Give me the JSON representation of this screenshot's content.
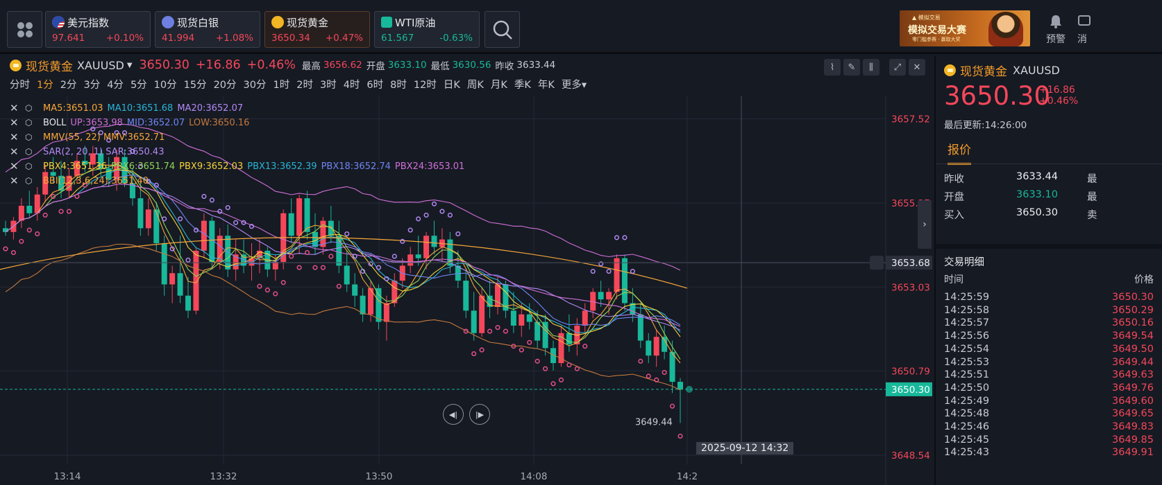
{
  "topbar": {
    "tickers": [
      {
        "name": "美元指数",
        "price": "97.641",
        "change": "+0.10%",
        "icon": "us-flag-icon",
        "dir": "up"
      },
      {
        "name": "现货白银",
        "price": "41.994",
        "change": "+1.08%",
        "icon": "silver-icon",
        "dir": "up"
      },
      {
        "name": "现货黄金",
        "price": "3650.34",
        "change": "+0.47%",
        "icon": "gold-icon",
        "dir": "up"
      },
      {
        "name": "WTI原油",
        "price": "61.567",
        "change": "-0.63%",
        "icon": "oil-icon",
        "dir": "down"
      }
    ],
    "banner": {
      "line1": "▲ 模拟交易",
      "line2": "模拟交易大赛",
      "line3": "零门槛参赛 · 赢取大奖"
    },
    "alert_label": "预警",
    "msg_label": "消"
  },
  "chart_header": {
    "symbol_name": "现货黄金",
    "symbol_code": "XAUUSD",
    "price": "3650.30",
    "change": "+16.86",
    "change_pct": "+0.46%",
    "high_label": "最高",
    "high": "3656.62",
    "open_label": "开盘",
    "open": "3633.10",
    "low_label": "最低",
    "low": "3630.56",
    "prev_label": "昨收",
    "prev": "3633.44"
  },
  "periods": [
    "分时",
    "1分",
    "2分",
    "3分",
    "4分",
    "5分",
    "10分",
    "15分",
    "20分",
    "30分",
    "1时",
    "2时",
    "3时",
    "4时",
    "6时",
    "8时",
    "12时",
    "日K",
    "周K",
    "月K",
    "季K",
    "年K",
    "更多"
  ],
  "active_period": "1分",
  "indicators": [
    {
      "items": [
        {
          "t": "MA5:3651.03",
          "c": "#f7a73a"
        },
        {
          "t": "MA10:3651.68",
          "c": "#28b5d6"
        },
        {
          "t": "MA20:3652.07",
          "c": "#b38af5"
        }
      ]
    },
    {
      "items": [
        {
          "t": "BOLL",
          "c": "#e6e7ea"
        },
        {
          "t": "UP:3653.98",
          "c": "#d070d8"
        },
        {
          "t": "MID:3652.07",
          "c": "#6f86f2"
        },
        {
          "t": "LOW:3650.16",
          "c": "#c57a3d"
        }
      ]
    },
    {
      "items": [
        {
          "t": "MMV(55, 22) MMV:3652.71",
          "c": "#f7a73a"
        }
      ]
    },
    {
      "items": [
        {
          "t": "SAR(2, 20, 1) SAR:3650.43",
          "c": "#b38af5"
        }
      ]
    },
    {
      "items": [
        {
          "t": "PBX4:3651.36",
          "c": "#f3d23a"
        },
        {
          "t": "PBX6:3651.74",
          "c": "#8fd45a"
        },
        {
          "t": "PBX9:3652.03",
          "c": "#f3d23a"
        },
        {
          "t": "PBX13:3652.39",
          "c": "#28b5d6"
        },
        {
          "t": "PBX18:3652.74",
          "c": "#6f86f2"
        },
        {
          "t": "PBX24:3653.01",
          "c": "#d070d8"
        }
      ]
    },
    {
      "items": [
        {
          "t": "BBI(12,3,6,24):3651.40",
          "c": "#f7a73a"
        }
      ]
    }
  ],
  "chart_data": {
    "type": "candlestick",
    "y_axis_labels": [
      "3657.52",
      "3655.27",
      "3653.03",
      "3650.79",
      "3648.54"
    ],
    "x_axis_labels": [
      "13:14",
      "13:32",
      "13:50",
      "14:08",
      "14:2"
    ],
    "ylim": [
      3648.3,
      3657.9
    ],
    "crosshair_value": "3653.68",
    "last_price_tag": "3650.30",
    "low_marker": "3649.44",
    "crosshair_date": "2025-09-12 14:32",
    "candles": [
      [
        3654.6,
        3654.8,
        3654.4,
        3654.5
      ],
      [
        3654.5,
        3654.9,
        3654.3,
        3654.8
      ],
      [
        3654.8,
        3655.4,
        3654.6,
        3655.2
      ],
      [
        3655.2,
        3655.6,
        3654.9,
        3655.0
      ],
      [
        3655.0,
        3655.7,
        3654.8,
        3655.5
      ],
      [
        3655.5,
        3656.3,
        3655.3,
        3656.1
      ],
      [
        3656.1,
        3656.5,
        3655.8,
        3656.0
      ],
      [
        3656.0,
        3656.4,
        3655.4,
        3655.6
      ],
      [
        3655.6,
        3656.2,
        3655.4,
        3656.0
      ],
      [
        3656.0,
        3656.6,
        3655.8,
        3656.4
      ],
      [
        3656.4,
        3656.8,
        3656.1,
        3656.3
      ],
      [
        3656.3,
        3656.8,
        3656.0,
        3656.6
      ],
      [
        3656.6,
        3656.7,
        3656.0,
        3656.2
      ],
      [
        3656.2,
        3656.5,
        3655.7,
        3655.9
      ],
      [
        3655.9,
        3656.7,
        3655.6,
        3656.5
      ],
      [
        3656.5,
        3656.7,
        3655.7,
        3655.8
      ],
      [
        3655.8,
        3656.2,
        3655.2,
        3655.4
      ],
      [
        3655.4,
        3655.8,
        3654.4,
        3654.6
      ],
      [
        3654.6,
        3655.4,
        3654.4,
        3655.1
      ],
      [
        3655.1,
        3655.3,
        3654.0,
        3654.2
      ],
      [
        3654.2,
        3654.4,
        3652.8,
        3653.1
      ],
      [
        3653.1,
        3653.6,
        3652.6,
        3653.4
      ],
      [
        3653.4,
        3654.4,
        3652.6,
        3652.8
      ],
      [
        3652.8,
        3653.3,
        3652.2,
        3652.4
      ],
      [
        3652.4,
        3654.1,
        3652.3,
        3654.0
      ],
      [
        3654.0,
        3655.0,
        3653.8,
        3654.8
      ],
      [
        3654.8,
        3654.9,
        3653.5,
        3653.7
      ],
      [
        3653.7,
        3654.6,
        3653.5,
        3654.4
      ],
      [
        3654.4,
        3654.7,
        3653.3,
        3653.5
      ],
      [
        3653.5,
        3654.3,
        3653.2,
        3653.9
      ],
      [
        3653.9,
        3654.3,
        3653.4,
        3653.6
      ],
      [
        3653.6,
        3654.2,
        3653.2,
        3653.8
      ],
      [
        3653.8,
        3654.3,
        3653.4,
        3654.0
      ],
      [
        3654.0,
        3654.1,
        3653.3,
        3653.5
      ],
      [
        3653.5,
        3653.9,
        3653.2,
        3653.7
      ],
      [
        3653.7,
        3655.1,
        3653.5,
        3655.0
      ],
      [
        3655.0,
        3655.4,
        3654.2,
        3654.4
      ],
      [
        3654.4,
        3655.5,
        3653.9,
        3655.4
      ],
      [
        3655.4,
        3655.6,
        3654.3,
        3654.5
      ],
      [
        3654.5,
        3655.0,
        3653.9,
        3654.1
      ],
      [
        3654.1,
        3654.9,
        3653.9,
        3654.8
      ],
      [
        3654.8,
        3655.2,
        3654.2,
        3654.4
      ],
      [
        3654.4,
        3654.8,
        3653.4,
        3653.6
      ],
      [
        3653.6,
        3654.0,
        3652.9,
        3653.1
      ],
      [
        3653.1,
        3653.4,
        3652.5,
        3652.8
      ],
      [
        3652.8,
        3653.0,
        3652.1,
        3652.3
      ],
      [
        3652.3,
        3653.2,
        3652.1,
        3653.0
      ],
      [
        3653.0,
        3653.1,
        3651.9,
        3652.1
      ],
      [
        3652.1,
        3652.8,
        3651.6,
        3652.6
      ],
      [
        3652.6,
        3653.4,
        3652.5,
        3653.2
      ],
      [
        3653.2,
        3653.8,
        3653.0,
        3653.6
      ],
      [
        3653.6,
        3654.1,
        3653.4,
        3653.9
      ],
      [
        3653.9,
        3654.4,
        3653.6,
        3653.8
      ],
      [
        3653.8,
        3654.5,
        3653.5,
        3654.4
      ],
      [
        3654.4,
        3654.8,
        3653.9,
        3654.1
      ],
      [
        3654.1,
        3654.6,
        3653.7,
        3654.3
      ],
      [
        3654.3,
        3654.5,
        3653.4,
        3653.6
      ],
      [
        3653.6,
        3654.0,
        3653.0,
        3653.2
      ],
      [
        3653.2,
        3653.5,
        3652.2,
        3652.4
      ],
      [
        3652.4,
        3652.9,
        3651.6,
        3651.8
      ],
      [
        3651.8,
        3653.0,
        3651.7,
        3652.8
      ],
      [
        3652.8,
        3653.2,
        3652.2,
        3652.5
      ],
      [
        3652.5,
        3653.3,
        3652.3,
        3653.1
      ],
      [
        3653.1,
        3653.2,
        3652.2,
        3652.4
      ],
      [
        3652.4,
        3652.9,
        3651.8,
        3652.0
      ],
      [
        3652.0,
        3652.6,
        3651.7,
        3652.3
      ],
      [
        3652.3,
        3652.6,
        3651.9,
        3652.1
      ],
      [
        3652.1,
        3652.4,
        3651.4,
        3651.6
      ],
      [
        3652.1,
        3652.3,
        3651.2,
        3651.4
      ],
      [
        3651.4,
        3651.6,
        3650.8,
        3651.0
      ],
      [
        3651.0,
        3652.0,
        3650.9,
        3651.8
      ],
      [
        3651.8,
        3652.3,
        3651.3,
        3651.5
      ],
      [
        3651.5,
        3652.2,
        3651.2,
        3652.0
      ],
      [
        3652.0,
        3652.6,
        3651.8,
        3652.4
      ],
      [
        3652.4,
        3653.0,
        3652.2,
        3652.9
      ],
      [
        3652.9,
        3653.2,
        3652.5,
        3652.7
      ],
      [
        3652.7,
        3653.0,
        3652.3,
        3652.9
      ],
      [
        3652.9,
        3653.9,
        3652.7,
        3653.8
      ],
      [
        3653.8,
        3653.9,
        3652.4,
        3652.6
      ],
      [
        3652.6,
        3653.0,
        3652.1,
        3652.3
      ],
      [
        3652.3,
        3652.6,
        3651.4,
        3651.6
      ],
      [
        3651.6,
        3651.8,
        3651.0,
        3651.2
      ],
      [
        3651.2,
        3651.9,
        3650.9,
        3651.7
      ],
      [
        3651.7,
        3652.0,
        3651.1,
        3651.3
      ],
      [
        3651.3,
        3651.6,
        3650.2,
        3650.5
      ],
      [
        3650.5,
        3650.6,
        3649.4,
        3650.3
      ]
    ]
  },
  "right_panel": {
    "symbol_name": "现货黄金",
    "symbol_code": "XAUUSD",
    "price": "3650.30",
    "change": "+16.86",
    "change_pct": "+0.46%",
    "updated": "最后更新:14:26:00",
    "tab": "报价",
    "quotes": [
      {
        "label": "昨收",
        "value": "3633.44",
        "label2": "最",
        "cls": ""
      },
      {
        "label": "开盘",
        "value": "3633.10",
        "label2": "最",
        "cls": "down"
      },
      {
        "label": "买入",
        "value": "3650.30",
        "label2": "卖",
        "cls": ""
      }
    ],
    "trades_title": "交易明细",
    "trades_head": {
      "time": "时间",
      "price": "价格"
    },
    "trades": [
      [
        "14:25:59",
        "3650.30"
      ],
      [
        "14:25:58",
        "3650.29"
      ],
      [
        "14:25:57",
        "3650.16"
      ],
      [
        "14:25:56",
        "3649.54"
      ],
      [
        "14:25:54",
        "3649.50"
      ],
      [
        "14:25:53",
        "3649.44"
      ],
      [
        "14:25:51",
        "3649.63"
      ],
      [
        "14:25:50",
        "3649.76"
      ],
      [
        "14:25:49",
        "3649.60"
      ],
      [
        "14:25:48",
        "3649.65"
      ],
      [
        "14:25:46",
        "3649.83"
      ],
      [
        "14:25:45",
        "3649.85"
      ],
      [
        "14:25:43",
        "3649.91"
      ]
    ]
  }
}
